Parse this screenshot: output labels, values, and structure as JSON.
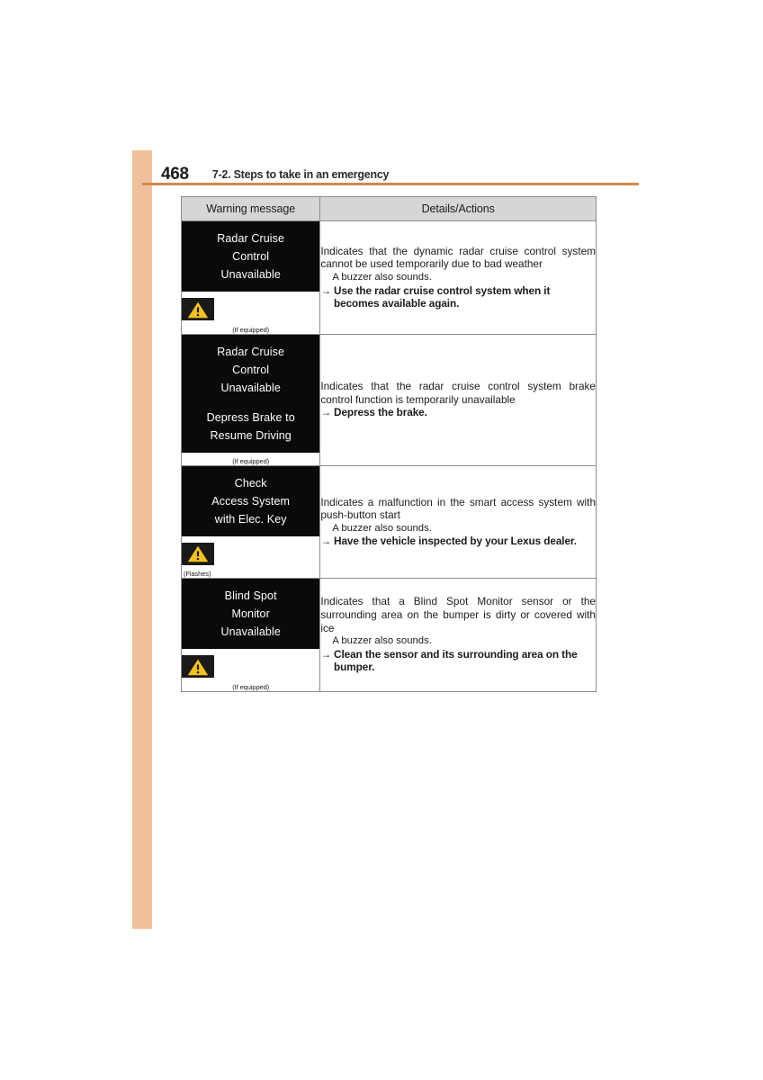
{
  "page": {
    "number": "468",
    "section_title": "7-2. Steps to take in an emergency",
    "accent_color": "#d4884b",
    "sidebar_color": "#eec19c"
  },
  "table": {
    "headers": {
      "warning_message": "Warning message",
      "details_actions": "Details/Actions"
    },
    "rows": [
      {
        "display_lines": [
          "Radar Cruise",
          "Control",
          "Unavailable"
        ],
        "icon": "warning-triangle-icon",
        "caption": "(If equipped)",
        "details": {
          "indicates": "Indicates that the dynamic radar cruise control system cannot be used temporarily due to bad weather",
          "buzzer": "A buzzer also sounds.",
          "arrow": "→",
          "action": "Use the radar cruise control system when it",
          "action_cont": "becomes available again."
        }
      },
      {
        "display_lines": [
          "Radar Cruise",
          "Control",
          "Unavailable",
          "",
          "Depress Brake to",
          "Resume Driving"
        ],
        "icon": null,
        "caption": "(If equipped)",
        "details": {
          "indicates": "Indicates that the radar cruise control system brake control function is temporarily unavailable",
          "buzzer": null,
          "arrow": "→",
          "action": "Depress the brake.",
          "action_cont": null
        }
      },
      {
        "display_lines": [
          "Check",
          "Access System",
          "with Elec. Key"
        ],
        "icon": "warning-triangle-icon",
        "caption": "(Flashes)",
        "details": {
          "indicates": "Indicates a malfunction in the smart access system with push-button start",
          "buzzer": "A buzzer also sounds.",
          "arrow": "→",
          "action": "Have the vehicle inspected by your Lexus dealer.",
          "action_cont": null
        }
      },
      {
        "display_lines": [
          "Blind Spot",
          "Monitor",
          "Unavailable"
        ],
        "icon": "warning-triangle-icon",
        "caption": "(If equipped)",
        "details": {
          "indicates": "Indicates that a Blind Spot Monitor sensor or the surrounding area on the bumper is dirty or covered with ice",
          "buzzer": "A buzzer also sounds.",
          "arrow": "→",
          "action": "Clean the sensor and its surrounding area on the",
          "action_cont": "bumper."
        }
      }
    ]
  },
  "icons": {
    "warning_triangle": {
      "name": "warning-triangle-icon",
      "triangle_color": "#f4c21b",
      "background_color": "#1a1a1a"
    }
  }
}
